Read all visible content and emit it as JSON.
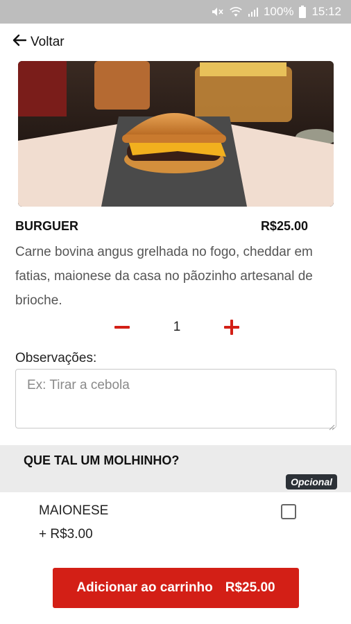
{
  "status_bar": {
    "battery": "100%",
    "time": "15:12",
    "icons": [
      "mute-icon",
      "wifi-icon",
      "signal-icon",
      "battery-icon"
    ]
  },
  "nav": {
    "back_label": "Voltar"
  },
  "product": {
    "image_alt": "burger-photo",
    "name": "BURGUER",
    "price": "R$25.00",
    "description": "Carne bovina angus grelhada no fogo, cheddar em fatias, maionese da casa no pãozinho artesanal de brioche."
  },
  "quantity": {
    "value": "1"
  },
  "notes": {
    "label": "Observações:",
    "placeholder": "Ex: Tirar a cebola",
    "value": ""
  },
  "addons": {
    "title": "QUE TAL UM MOLHINHO?",
    "badge": "Opcional",
    "options": [
      {
        "name": "MAIONESE",
        "price": "+ R$3.00",
        "checked": false
      }
    ]
  },
  "cart_button": {
    "label": "Adicionar ao carrinho",
    "price": "R$25.00"
  },
  "colors": {
    "accent": "#d31f16",
    "status_bar": "#bdbdbd",
    "section_bg": "#ebebeb",
    "badge_bg": "#2c3137"
  }
}
